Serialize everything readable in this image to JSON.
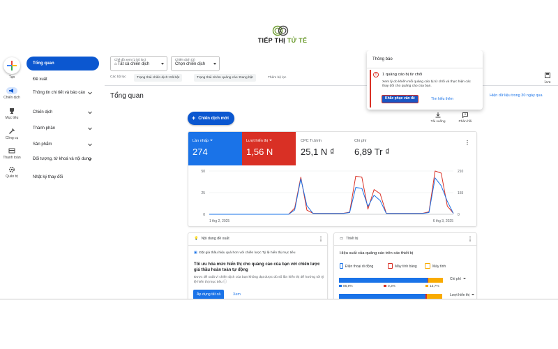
{
  "brand": {
    "prefix": "TIẾP THỊ",
    "suffix": "TỬ TẾ"
  },
  "rail": {
    "create_label": "Tạo",
    "items": [
      {
        "label": "Chiến dịch",
        "icon": "campaign-icon",
        "active": true
      },
      {
        "label": "Mục tiêu",
        "icon": "trophy-icon",
        "active": false
      },
      {
        "label": "Công cụ",
        "icon": "tools-icon",
        "active": false
      },
      {
        "label": "Thanh toán",
        "icon": "credit-card-icon",
        "active": false
      },
      {
        "label": "Quản trị",
        "icon": "admin-gear-icon",
        "active": false
      }
    ]
  },
  "nav": {
    "items": [
      {
        "label": "Tổng quan",
        "active": true
      },
      {
        "label": "Đề xuất"
      },
      {
        "label": "Thông tin chi tiết và báo cáo",
        "chevron": true
      },
      {
        "label": "Chiến dịch",
        "chevron": true
      },
      {
        "label": "Thành phần",
        "chevron": true
      },
      {
        "label": "Sản phẩm",
        "chevron": true
      },
      {
        "label": "Đối tượng, từ khoá và nội dung",
        "chevron": true
      },
      {
        "label": "Nhật ký thay đổi"
      }
    ]
  },
  "filters": {
    "view_label": "Chế độ xem (2 bộ lọc)",
    "view_value": "Tất cả chiến dịch",
    "campaign_label": "Chiến dịch (3)",
    "campaign_value": "Chọn chiến dịch",
    "row_label": "Các bộ lọc",
    "chip1": "Trạng thái chiến dịch: Đã bật",
    "chip2": "Trạng thái nhóm quảng cáo: Đang bật",
    "add_filter": "Thêm bộ lọc"
  },
  "page": {
    "title": "Tổng quan",
    "date_range": "Hiện dữ liệu trong 30 ngày qua",
    "save_label": "Lưu",
    "new_campaign": "Chiến dịch mới",
    "download_label": "Tải xuống",
    "feedback_label": "Phản hồi"
  },
  "metrics": [
    {
      "name": "Lần nhấp",
      "value": "274",
      "style": "blue"
    },
    {
      "name": "Lượt hiển thị",
      "value": "1,56 N",
      "style": "red"
    },
    {
      "name": "CPC Tr.bình",
      "value": "25,1 N ₫",
      "style": "plain"
    },
    {
      "name": "Chi phí",
      "value": "6,89 Tr ₫",
      "style": "plain"
    }
  ],
  "chart_data": {
    "type": "line",
    "x_start_label": "1 thg 2, 2025",
    "x_end_label": "6 thg 3, 2025",
    "left_axis_ticks": [
      "50",
      "25",
      "0"
    ],
    "right_axis_ticks": [
      "210",
      "155",
      "0"
    ],
    "ylim_left": [
      0,
      50
    ],
    "ylim_right": [
      0,
      210
    ],
    "series": [
      {
        "name": "Lần nhấp",
        "color": "#1a73e8",
        "axis": "left",
        "values": [
          0,
          0,
          0,
          0,
          0,
          0,
          0,
          0,
          0,
          0,
          0,
          0,
          0,
          0,
          5,
          41,
          10,
          1,
          1,
          1,
          1,
          1,
          1,
          2,
          31,
          30,
          9,
          22,
          16,
          1,
          1,
          1,
          1,
          1,
          1,
          1,
          2,
          42,
          33,
          15,
          1
        ]
      },
      {
        "name": "Lượt hiển thị",
        "color": "#d93025",
        "axis": "right",
        "values": [
          0,
          0,
          0,
          0,
          0,
          0,
          0,
          0,
          0,
          0,
          0,
          0,
          0,
          0,
          30,
          180,
          20,
          5,
          5,
          5,
          5,
          5,
          5,
          10,
          185,
          180,
          25,
          120,
          100,
          5,
          5,
          5,
          5,
          5,
          5,
          5,
          12,
          210,
          200,
          40,
          5
        ]
      }
    ]
  },
  "recommendations": {
    "header": "Nội dung đề xuất",
    "subtitle": "Đặt giá thầu hiệu quả hơn với chiến lược Tỷ lệ hiển thị mục tiêu",
    "title": "Tối ưu hóa mức hiển thị cho quảng cáo của bạn với chiến lược giá thầu hoàn toàn tự động",
    "desc": "Được đề xuất vì chiến dịch của bạn không đạt được đủ số lần hiển thị để hướng tới tỷ lệ hiển thị mục tiêu",
    "apply": "Áp dụng tất cả",
    "view": "Xem"
  },
  "devices": {
    "header": "Thiết bị",
    "title": "Hiệu suất của quảng cáo trên các thiết bị",
    "legend": [
      "Điện thoại di động",
      "Máy tính bảng",
      "Máy tính"
    ],
    "colors": [
      "#1a73e8",
      "#d93025",
      "#f9ab00"
    ],
    "metric1": "Chi phí",
    "metric2": "Lượt hiển thị",
    "cost_split": [
      86.9,
      0.3,
      13.7
    ],
    "cost_labels": [
      "86,9%",
      "0,3%",
      "13,7%"
    ],
    "impr_split": [
      84,
      1,
      15
    ]
  },
  "notification": {
    "title": "Thông báo",
    "head": "1 quảng cáo bị từ chối",
    "desc": "Xem lý do khiến mỗi quảng cáo bị từ chối và thực hiện các thay đổi cho quảng cáo của bạn.",
    "fix": "Khắc phục vấn đề",
    "learn": "Tìm hiểu thêm"
  }
}
